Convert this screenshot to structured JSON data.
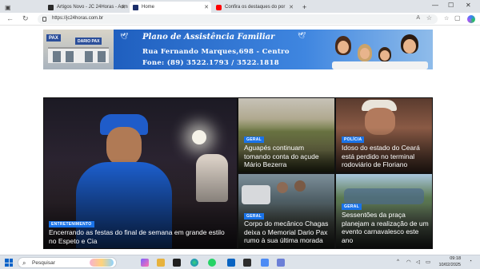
{
  "browser": {
    "tabs": [
      {
        "title": "Artigos Novo - JC 24Horas - Adm",
        "active": false,
        "color": "#2b2b2b"
      },
      {
        "title": "Home",
        "active": true,
        "color": "#1c2f6b"
      },
      {
        "title": "Confira os destaques do por",
        "active": false,
        "color": "#ff0000"
      }
    ],
    "new_tab": "+",
    "url": "https://jc24horas.com.br",
    "controls": {
      "minimize": "—",
      "maximize": "☐",
      "close": "✕"
    }
  },
  "banner": {
    "title": "Plano de Assistência Familiar",
    "address": "Rua Fernando Marques,698 - Centro",
    "phone": "Fone: (89) 3522.1793 / 3522.1818",
    "store_sign_1": "PAX",
    "store_sign_2": "DARIO PAX"
  },
  "news": [
    {
      "category": "Entretenimento",
      "title": "Encerrando as festas do final de semana em grande estilo no Espeto e Cia"
    },
    {
      "category": "Geral",
      "title": "Aguapés continuam tomando conta do açude Mário Bezerra"
    },
    {
      "category": "Polícia",
      "title": "Idoso do estado do Ceará está perdido no terminal rodoviário de Floriano"
    },
    {
      "category": "Geral",
      "title": "Corpo do mecânico Chagas deixa o Memorial Dario Pax rumo à sua última morada"
    },
    {
      "category": "Geral",
      "title": "Sessentões da praça planejam a realização de um evento carnavalesco este ano"
    }
  ],
  "taskbar": {
    "search_placeholder": "Pesquisar",
    "time": "09:18",
    "date": "10/02/2025"
  },
  "colors": {
    "badge": "#1a73e8",
    "banner_blue": "#1f5fbf",
    "tabbar": "#dfe3e8"
  }
}
